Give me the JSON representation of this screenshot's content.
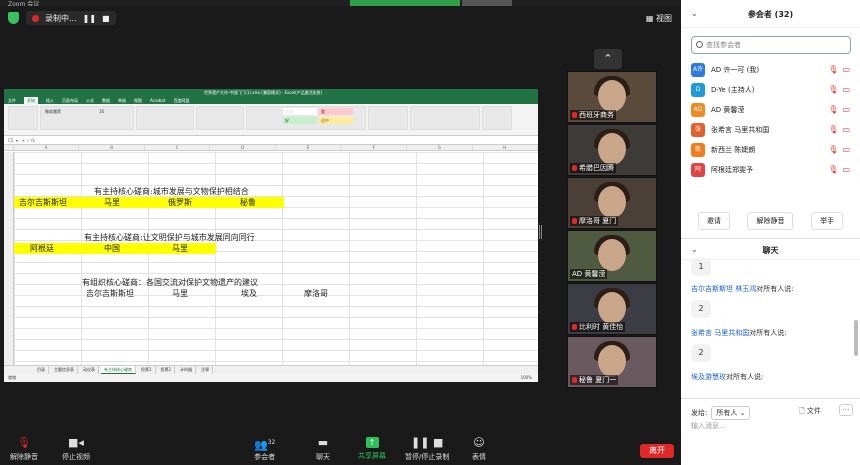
{
  "window": {
    "title": "Zoom 会议"
  },
  "top": {
    "recording_label": "录制中...",
    "view_label": "视图"
  },
  "excel": {
    "title": "世界遗产大作·中国门门(1).xlsx [兼容模式] - Excel(产品激活失败)",
    "tabs": [
      "文件",
      "开始",
      "插入",
      "页面布局",
      "公式",
      "数据",
      "审阅",
      "视图",
      "Acrobat",
      "百度网盘"
    ],
    "active_tab": "开始",
    "font_name": "微软雅黑",
    "font_size": "16",
    "styles": [
      "常规",
      "差",
      "好",
      "适中",
      "计算",
      "检查单元格"
    ],
    "cell_ref": "C5",
    "columns": [
      "A",
      "B",
      "C",
      "D",
      "E",
      "F",
      "G",
      "H"
    ],
    "blocks": [
      {
        "heading": "有主持核心磋商:城市发展与文物保护相结合",
        "countries": [
          "吉尔吉斯斯坦",
          "马里",
          "俄罗斯",
          "秘鲁"
        ]
      },
      {
        "heading": "有主持核心磋商:让文明保护与城市发展同向同行",
        "countries": [
          "阿根廷",
          "中国",
          "马里"
        ]
      },
      {
        "heading": "有组织核心磋商：各国交流对保护文物遗产的建议",
        "countries": [
          "吉尔吉斯斯坦",
          "马里",
          "埃及",
          "摩洛哥"
        ]
      }
    ],
    "sheets": [
      "目录",
      "主题信息表",
      "动议表",
      "有主持核心磋商",
      "投票1",
      "投票2",
      "计时器",
      "注释"
    ],
    "active_sheet": "有主持核心磋商",
    "status": "就绪",
    "zoom": "100%"
  },
  "videos": [
    {
      "name": "西班牙商务",
      "muted": true
    },
    {
      "name": "希腊巴因腾",
      "muted": true
    },
    {
      "name": "摩洛哥 夏门",
      "muted": true
    },
    {
      "name": "AD 黄馨滢",
      "muted": false
    },
    {
      "name": "比利时 黄佳怡",
      "muted": true
    },
    {
      "name": "秘鲁 夏门一",
      "muted": true
    }
  ],
  "toolbar": {
    "mute": "解除静音",
    "video": "停止视频",
    "participants": "参会者",
    "participants_count": "32",
    "chat": "聊天",
    "share": "共享屏幕",
    "pause_record": "暂停/停止录制",
    "reactions": "表情",
    "leave": "离开"
  },
  "participants_panel": {
    "title": "参会者 (32)",
    "search_placeholder": "查找参会者",
    "list": [
      {
        "avatar": "A许",
        "name": "AD 许一可 (我)",
        "color": "#2d7be0"
      },
      {
        "avatar": "D",
        "name": "D-Ye (主持人)",
        "color": "#1f9ad6"
      },
      {
        "avatar": "AD",
        "name": "AD 黄馨滢",
        "color": "#f08a24"
      },
      {
        "avatar": "张",
        "name": "张希言 马里共和国",
        "color": "#e0612a"
      },
      {
        "avatar": "新",
        "name": "新西兰 陈婕朗",
        "color": "#f07c1e"
      },
      {
        "avatar": "阿",
        "name": "阿根廷郑雯予",
        "color": "#e04545"
      }
    ],
    "buttons": [
      "邀请",
      "解除静音",
      "举手"
    ]
  },
  "chat": {
    "title": "聊天",
    "messages": [
      {
        "sender": "",
        "to": "",
        "text": "1"
      },
      {
        "sender": "吉尔吉斯斯坦 林玉鸿",
        "to": "对所有人说:",
        "text": "2"
      },
      {
        "sender": "张希言 马里共和国",
        "to": "对所有人说:",
        "text": "2"
      },
      {
        "sender": "埃及游慧玫",
        "to": "对所有人说:",
        "text": ""
      }
    ],
    "send_to_label": "发给:",
    "send_to_value": "所有人",
    "file_label": "文件",
    "input_placeholder": "输入消息..."
  }
}
